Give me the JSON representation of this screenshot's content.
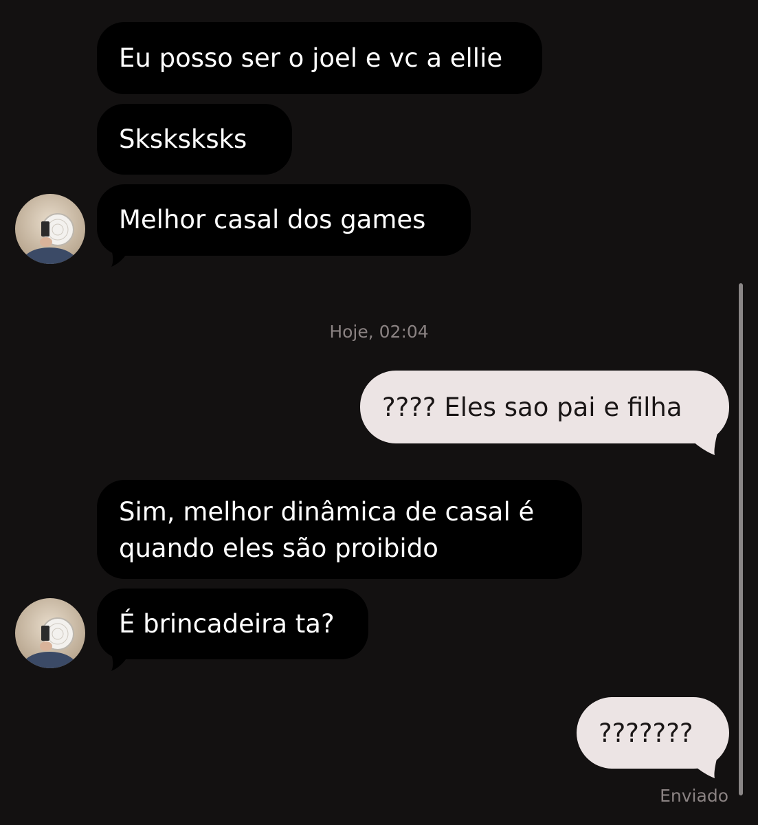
{
  "messages": [
    {
      "text": "Eu posso ser o joel e vc a ellie"
    },
    {
      "text": "Sksksksks"
    },
    {
      "text": "Melhor casal dos games"
    },
    {
      "text": "???? Eles sao pai e filha"
    },
    {
      "line1": "Sim, melhor dinâmica de casal é",
      "line2": "quando eles são proibido"
    },
    {
      "text": "É brincadeira ta?"
    },
    {
      "text": "???????"
    }
  ],
  "timestamp": "Hoje, 02:04",
  "status": "Enviado",
  "colors": {
    "background": "#131111",
    "incoming_bubble": "#000000",
    "outgoing_bubble": "#ece4e4",
    "meta_text": "#8a8282"
  },
  "icons": {
    "avatar": "contact-avatar"
  }
}
